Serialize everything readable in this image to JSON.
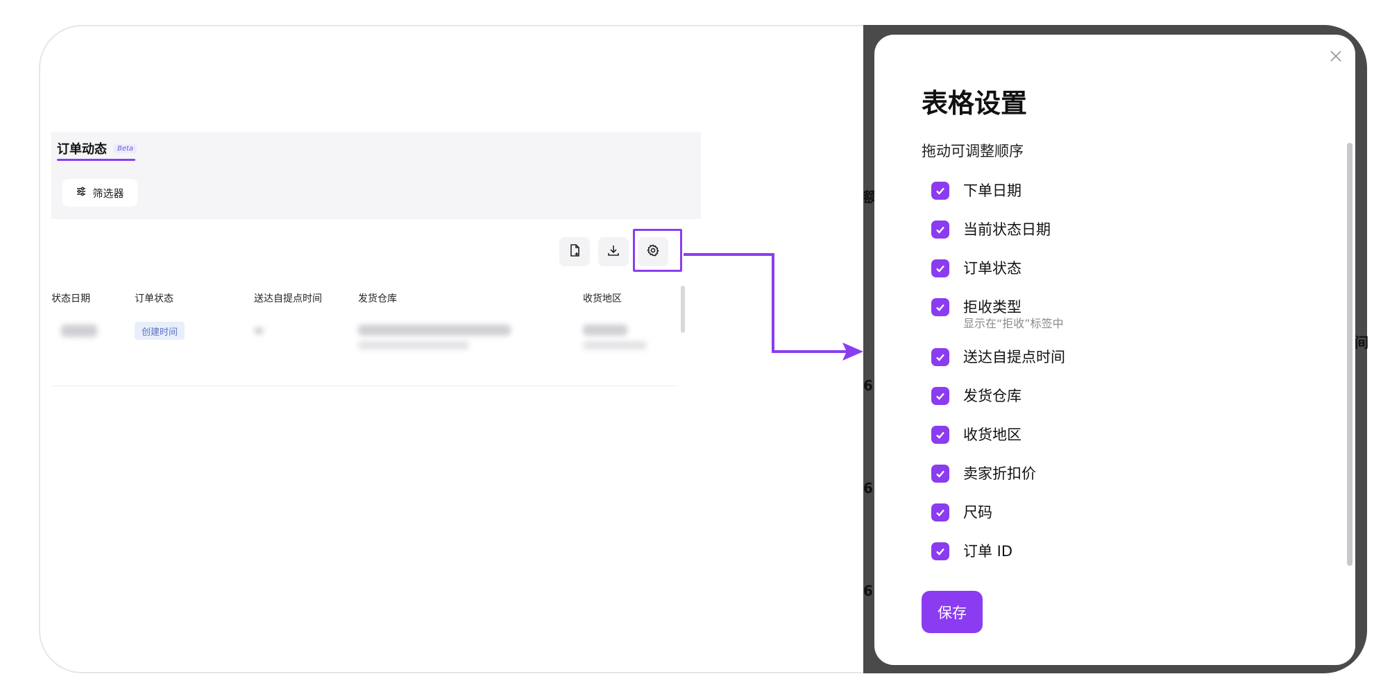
{
  "left_page": {
    "tab_label": "订单动态",
    "tab_badge": "Beta",
    "filter_label": "筛选器",
    "columns": [
      "状态日期",
      "订单状态",
      "送达自提点时间",
      "发货仓库",
      "收货地区"
    ],
    "row_status": "创建时间",
    "toolbar_icons": [
      "file-add-icon",
      "download-icon",
      "gear-icon"
    ]
  },
  "modal": {
    "title": "表格设置",
    "subtitle": "拖动可调整顺序",
    "options": [
      {
        "label": "下单日期",
        "checked": true
      },
      {
        "label": "当前状态日期",
        "checked": true
      },
      {
        "label": "订单状态",
        "checked": true
      },
      {
        "label": "拒收类型",
        "hint": "显示在“拒收”标签中",
        "checked": true
      },
      {
        "label": "送达自提点时间",
        "checked": true
      },
      {
        "label": "发货仓库",
        "checked": true
      },
      {
        "label": "收货地区",
        "checked": true
      },
      {
        "label": "卖家折扣价",
        "checked": true
      },
      {
        "label": "尺码",
        "checked": true
      },
      {
        "label": "订单 ID",
        "checked": true
      }
    ],
    "save_label": "保存",
    "close_icon": "close-icon"
  },
  "edge_fragments": [
    "额",
    "6",
    "6",
    "6",
    "间"
  ],
  "colors": {
    "accent": "#8b3cf0",
    "overlay": "#4a4a4a"
  }
}
